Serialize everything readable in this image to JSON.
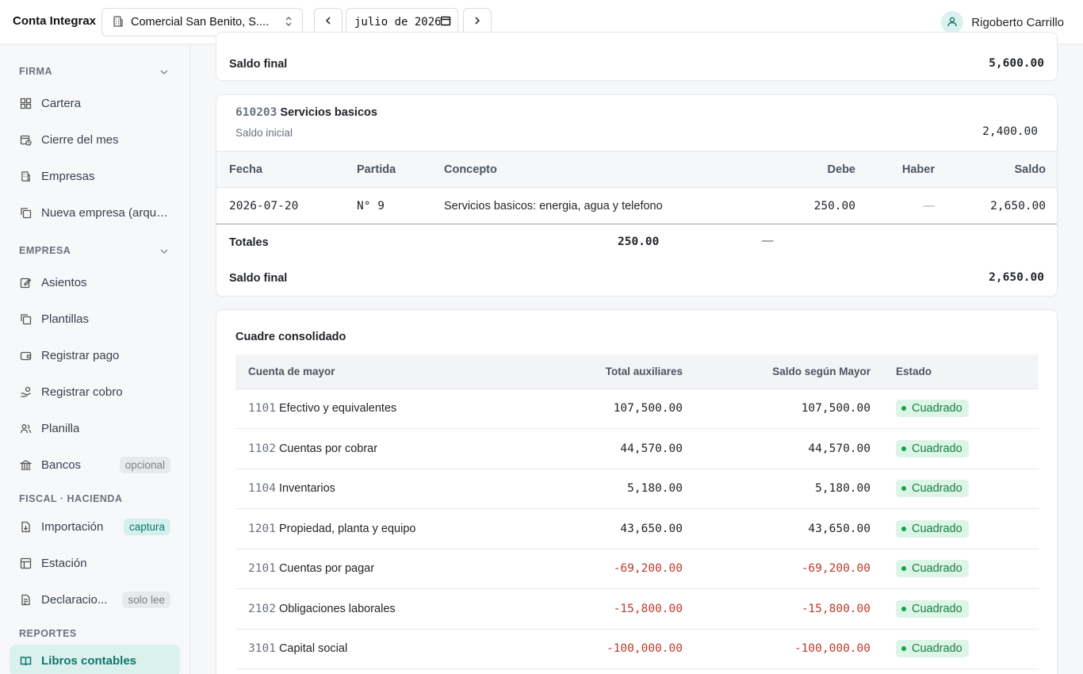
{
  "header": {
    "brand": "Conta Integrax",
    "company": "Comercial San Benito, S....",
    "month": "julio de 2026",
    "user_name": "Rigoberto Carrillo"
  },
  "sidebar": {
    "sections": {
      "firma": "FIRMA",
      "empresa": "EMPRESA",
      "fiscal": "FISCAL · HACIENDA",
      "reportes": "REPORTES"
    },
    "items": {
      "cartera": "Cartera",
      "cierre": "Cierre del mes",
      "empresas": "Empresas",
      "nueva": "Nueva empresa (arque...",
      "asientos": "Asientos",
      "plantillas": "Plantillas",
      "pago": "Registrar pago",
      "cobro": "Registrar cobro",
      "planilla": "Planilla",
      "bancos": "Bancos",
      "bancos_pill": "opcional",
      "importacion": "Importación",
      "importacion_pill": "captura",
      "estacion": "Estación",
      "declaraciones": "Declaracio...",
      "declaraciones_pill": "solo lee",
      "libros": "Libros contables"
    }
  },
  "prev_card": {
    "saldo_final_label": "Saldo final",
    "saldo_final_value": "5,600.00"
  },
  "account_card": {
    "code": "610203",
    "name": "Servicios basicos",
    "saldo_inicial_label": "Saldo inicial",
    "saldo_inicial_value": "2,400.00",
    "columns": {
      "fecha": "Fecha",
      "partida": "Partida",
      "concepto": "Concepto",
      "debe": "Debe",
      "haber": "Haber",
      "saldo": "Saldo"
    },
    "row": {
      "fecha": "2026-07-20",
      "partida": "N° 9",
      "concepto": "Servicios basicos: energia, agua y telefono",
      "debe": "250.00",
      "haber": "—",
      "saldo": "2,650.00"
    },
    "totales_label": "Totales",
    "totales_debe": "250.00",
    "totales_haber": "—",
    "saldo_final_label": "Saldo final",
    "saldo_final_value": "2,650.00"
  },
  "consolidado": {
    "title": "Cuadre consolidado",
    "columns": {
      "cuenta": "Cuenta de mayor",
      "total": "Total auxiliares",
      "saldo": "Saldo según Mayor",
      "estado": "Estado"
    },
    "rows": [
      {
        "code": "1101",
        "name": "Efectivo y equivalentes",
        "total": "107,500.00",
        "saldo": "107,500.00",
        "estado": "Cuadrado"
      },
      {
        "code": "1102",
        "name": "Cuentas por cobrar",
        "total": "44,570.00",
        "saldo": "44,570.00",
        "estado": "Cuadrado"
      },
      {
        "code": "1104",
        "name": "Inventarios",
        "total": "5,180.00",
        "saldo": "5,180.00",
        "estado": "Cuadrado"
      },
      {
        "code": "1201",
        "name": "Propiedad, planta y equipo",
        "total": "43,650.00",
        "saldo": "43,650.00",
        "estado": "Cuadrado"
      },
      {
        "code": "2101",
        "name": "Cuentas por pagar",
        "total": "-69,200.00",
        "saldo": "-69,200.00",
        "estado": "Cuadrado"
      },
      {
        "code": "2102",
        "name": "Obligaciones laborales",
        "total": "-15,800.00",
        "saldo": "-15,800.00",
        "estado": "Cuadrado"
      },
      {
        "code": "3101",
        "name": "Capital social",
        "total": "-100,000.00",
        "saldo": "-100,000.00",
        "estado": "Cuadrado"
      }
    ]
  },
  "colors": {
    "accent": "#0f766e",
    "negative": "#c0392b",
    "success": "#15803d"
  }
}
